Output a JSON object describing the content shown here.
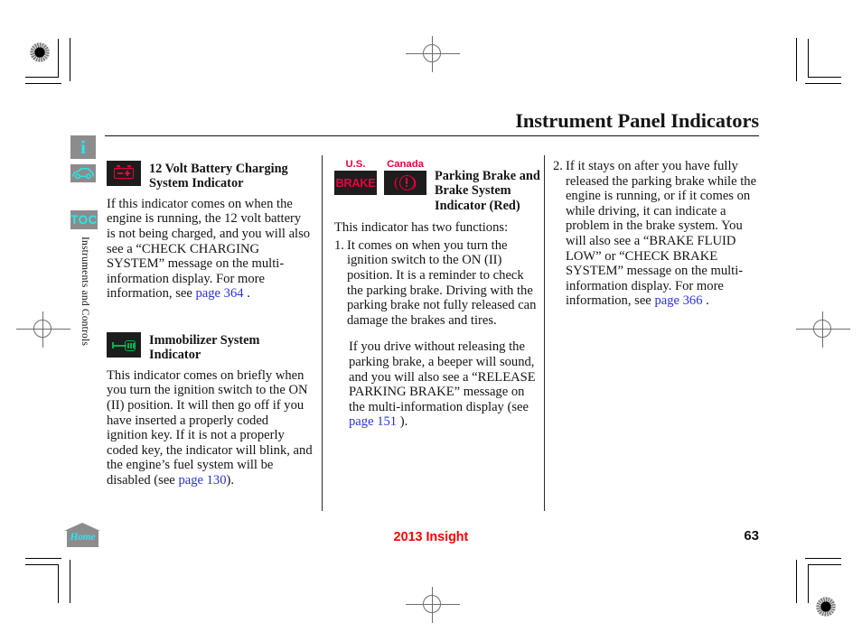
{
  "header": {
    "title": "Instrument Panel Indicators"
  },
  "sidebar": {
    "tabs": [
      {
        "name": "info",
        "glyph": "i"
      },
      {
        "name": "vehicle",
        "glyph": ""
      },
      {
        "name": "toc",
        "glyph": "TOC"
      }
    ],
    "vertical_label": "Instruments and Controls",
    "home_label": "Home"
  },
  "columns": {
    "col1": {
      "indicator1": {
        "heading": "12 Volt Battery Charging System Indicator",
        "body_before_link": "If this indicator comes on when the engine is running, the 12 volt battery is not being charged, and you will also see a “CHECK CHARGING SYSTEM” message on the multi-information display. For more information, see ",
        "link": "page 364",
        "body_after_link": " ."
      },
      "indicator2": {
        "heading": "Immobilizer System Indicator",
        "body_before_link": "This indicator comes on briefly when you turn the ignition switch to the ON (II) position. It will then go off if you have inserted a properly coded ignition key. If it is not a properly coded key, the indicator will blink, and the engine’s fuel system will be disabled (see ",
        "link": "page 130",
        "body_after_link": ")."
      }
    },
    "col2": {
      "icon_caption_us": "U.S.",
      "icon_caption_canada": "Canada",
      "brake_word": "BRAKE",
      "heading": "Parking Brake and Brake System Indicator (Red)",
      "intro": "This indicator has two functions:",
      "item1_num": "1.",
      "item1_text": "It comes on when you turn the ignition switch to the ON (II) position. It is a reminder to check the parking brake. Driving with the parking brake not fully released can damage the brakes and tires.",
      "para2_before_link": "If you drive without releasing the parking brake, a beeper will sound, and you will also see a “RELEASE PARKING BRAKE” message on the multi-information display (see ",
      "para2_link": "page 151",
      "para2_after_link": " )."
    },
    "col3": {
      "item2_num": "2.",
      "item2_before_link": "If it stays on after you have fully released the parking brake while the engine is running, or if it comes on while driving, it can indicate a problem in the brake system. You will also see a “BRAKE FLUID LOW” or “CHECK BRAKE SYSTEM” message on the multi-information display. For more information, see ",
      "item2_link": "page 366",
      "item2_after_link": " ."
    }
  },
  "footer": {
    "model": "2013 Insight",
    "page_number": "63"
  },
  "colors": {
    "link": "#2933d8",
    "footer_red": "#ff0000",
    "indicator_red": "#e8003c",
    "indicator_green": "#00b451",
    "tab_gray": "#8c8c8c",
    "tab_cyan": "#27e8ee"
  }
}
